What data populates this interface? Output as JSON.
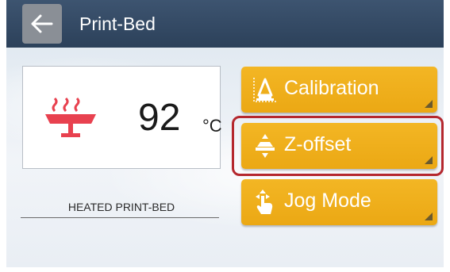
{
  "header": {
    "title": "Print-Bed",
    "back_icon": "arrow-left-icon"
  },
  "heater": {
    "icon": "heated-bed-icon",
    "icon_color": "#e8414f",
    "temperature": "92",
    "unit": "°C",
    "caption": "HEATED PRINT-BED"
  },
  "menu": {
    "accent": "#f0ae1c",
    "items": [
      {
        "label": "Calibration",
        "icon": "calibration-icon"
      },
      {
        "label": "Z-offset",
        "icon": "z-offset-icon",
        "highlighted": true
      },
      {
        "label": "Jog Mode",
        "icon": "jog-hand-icon"
      }
    ]
  },
  "highlight_color": "#b5282e"
}
